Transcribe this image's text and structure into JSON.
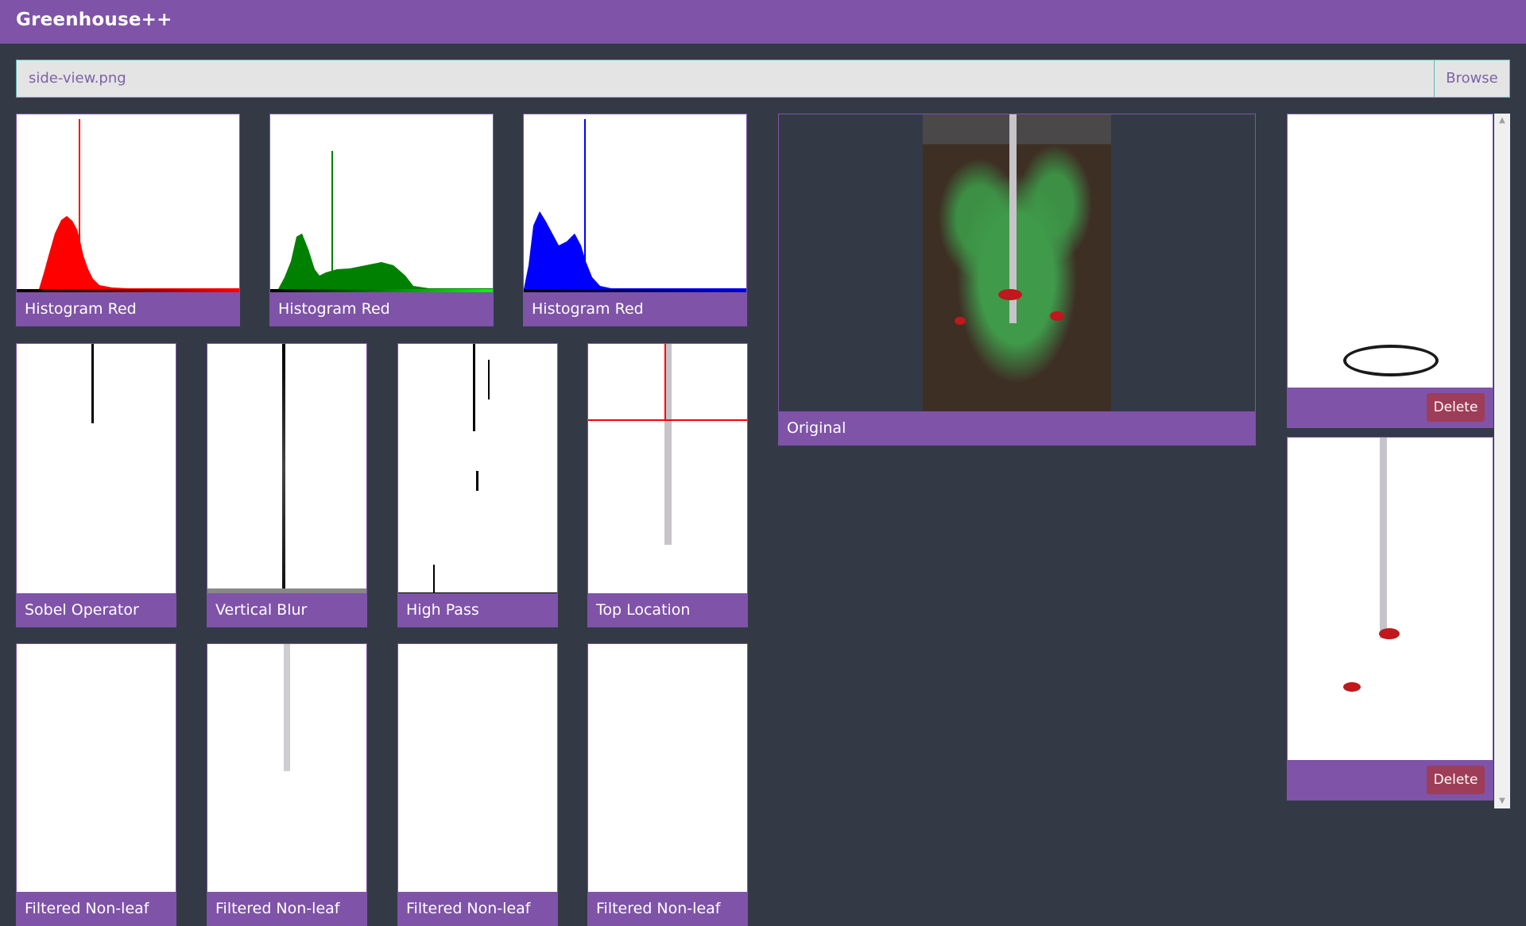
{
  "app": {
    "title": "Greenhouse++"
  },
  "file": {
    "value": "side-view.png",
    "browse_label": "Browse"
  },
  "histograms": [
    {
      "caption": "Histogram Red",
      "color": "#ff0000",
      "bar_color": "#ff0000"
    },
    {
      "caption": "Histogram Red",
      "color": "#008000",
      "bar_color": "#00ff00"
    },
    {
      "caption": "Histogram Red",
      "color": "#0000ff",
      "bar_color": "#0000cc"
    }
  ],
  "filters": [
    {
      "caption": "Sobel Operator"
    },
    {
      "caption": "Vertical Blur"
    },
    {
      "caption": "High Pass"
    },
    {
      "caption": "Top Location"
    }
  ],
  "masks": [
    {
      "caption": "Filtered Non-leaf"
    },
    {
      "caption": "Filtered Non-leaf"
    },
    {
      "caption": "Filtered Non-leaf"
    },
    {
      "caption": "Filtered Non-leaf"
    }
  ],
  "original": {
    "caption": "Original"
  },
  "gallery": [
    {
      "delete_label": "Delete"
    },
    {
      "delete_label": "Delete"
    }
  ]
}
